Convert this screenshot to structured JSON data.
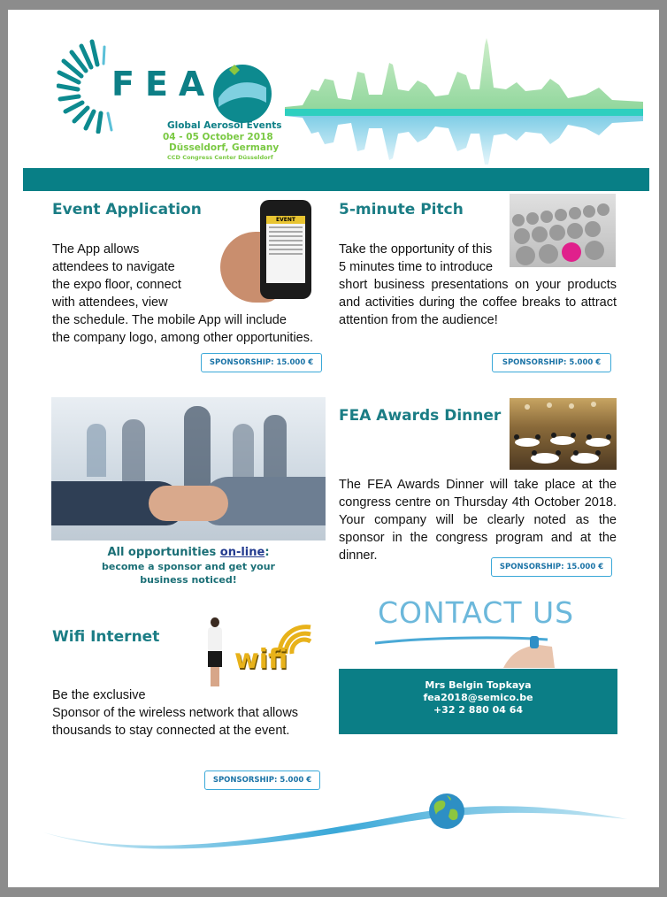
{
  "header": {
    "logo_text": "FEA",
    "subtitle": "Global Aerosol Events",
    "dates": "04 - 05 October 2018",
    "location": "Düsseldorf, Germany",
    "venue": "CCD Congress Center Düsseldorf"
  },
  "sections": {
    "event_app": {
      "title": "Event Application",
      "lines": [
        "The App allows",
        "attendees to navigate",
        "the expo floor, connect",
        "with attendees, view",
        "the schedule. The mobile App will include",
        "the company logo, among other opportunities."
      ],
      "sponsorship": "SPONSORSHIP: 15.000 €",
      "phone_header": "EVENT"
    },
    "pitch": {
      "title": "5-minute Pitch",
      "lines": [
        "Take the opportunity of this",
        "5 minutes time to introduce"
      ],
      "paragraph": "short business presentations on your products and activities during the coffee breaks to attract attention from the audience!",
      "sponsorship": "SPONSORSHIP: 5.000 €"
    },
    "online": {
      "line1_prefix": "All opportunities ",
      "line1_link": "on-line",
      "line1_suffix": ":",
      "line2": "become a sponsor and get your",
      "line3": "business noticed!"
    },
    "awards": {
      "title": "FEA Awards Dinner",
      "paragraph": "The FEA Awards Dinner will take place at the congress centre on Thursday 4th October 2018. Your company will be clearly noted as the sponsor in the congress program and at the dinner.",
      "sponsorship": "SPONSORSHIP: 15.000 €"
    },
    "wifi": {
      "title": "Wifi Internet",
      "lines": [
        "Be the exclusive",
        "Sponsor of the wireless network that allows",
        "thousands to stay connected at the event."
      ],
      "sponsorship": "SPONSORSHIP: 5.000 €",
      "wifi_word": "wifi"
    },
    "contact": {
      "heading": "CONTACT US",
      "name": "Mrs Belgin Topkaya",
      "email": "fea2018@semico.be",
      "phone": "+32 2 880 04 64"
    }
  },
  "colors": {
    "teal": "#087f86",
    "heading": "#1b7d85",
    "badge_border": "#3aa8d8",
    "green": "#7ac943"
  }
}
